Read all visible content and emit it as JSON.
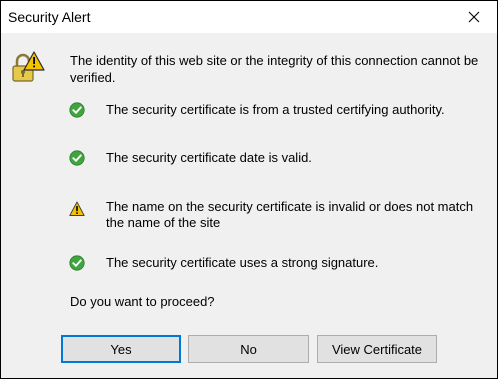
{
  "window": {
    "title": "Security Alert"
  },
  "dialog": {
    "intro": "The identity of this web site or the integrity of this connection cannot be verified.",
    "checks": [
      {
        "status": "ok",
        "icon": "check-circle-icon",
        "text": "The security certificate is from a trusted certifying authority."
      },
      {
        "status": "ok",
        "icon": "check-circle-icon",
        "text": "The security certificate date is valid."
      },
      {
        "status": "warning",
        "icon": "warning-triangle-icon",
        "text": "The name on the security certificate is invalid or does not match the name of the site"
      },
      {
        "status": "ok",
        "icon": "check-circle-icon",
        "text": "The security certificate uses a strong signature."
      }
    ],
    "question": "Do you want to proceed?"
  },
  "buttons": {
    "yes": "Yes",
    "no": "No",
    "view_certificate": "View Certificate"
  },
  "colors": {
    "ok_green": "#3fa53f",
    "warning_yellow": "#f3c300",
    "focus_blue": "#0078d7"
  }
}
